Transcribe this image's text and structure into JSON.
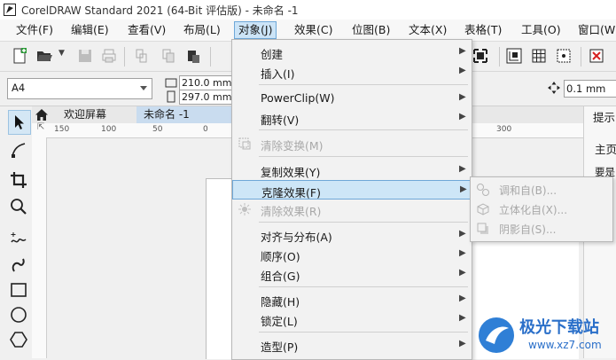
{
  "window": {
    "title": "CorelDRAW Standard 2021 (64-Bit 评估版) - 未命名 -1"
  },
  "menubar": [
    {
      "label": "文件(F)"
    },
    {
      "label": "编辑(E)"
    },
    {
      "label": "查看(V)"
    },
    {
      "label": "布局(L)"
    },
    {
      "label": "对象(J)",
      "active": true
    },
    {
      "label": "效果(C)"
    },
    {
      "label": "位图(B)"
    },
    {
      "label": "文本(X)"
    },
    {
      "label": "表格(T)"
    },
    {
      "label": "工具(O)"
    },
    {
      "label": "窗口(W)"
    }
  ],
  "propbar": {
    "page_size": "A4",
    "width": "210.0 mm",
    "height": "297.0 mm",
    "nudge": "0.1 mm"
  },
  "tabs": {
    "welcome": "欢迎屏幕",
    "document": "未命名 -1"
  },
  "ruler": {
    "ticks": [
      "150",
      "100",
      "50",
      "0",
      "300"
    ]
  },
  "docker": {
    "header": "提示",
    "line1": "主页",
    "line2": "要是"
  },
  "object_menu": [
    {
      "label": "创建",
      "submenu": true
    },
    {
      "label": "插入(I)",
      "submenu": true
    },
    {
      "sep": true
    },
    {
      "label": "PowerClip(W)",
      "submenu": true
    },
    {
      "label": "翻转(V)",
      "submenu": true
    },
    {
      "sep": true
    },
    {
      "label": "清除变换(M)",
      "disabled": true,
      "icon": "clear-transform-icon"
    },
    {
      "sep": true
    },
    {
      "label": "复制效果(Y)",
      "submenu": true
    },
    {
      "label": "克隆效果(F)",
      "submenu": true,
      "highlighted": true
    },
    {
      "label": "清除效果(R)",
      "disabled": true,
      "icon": "clear-effect-icon"
    },
    {
      "sep": true
    },
    {
      "label": "对齐与分布(A)",
      "submenu": true
    },
    {
      "label": "顺序(O)",
      "submenu": true
    },
    {
      "label": "组合(G)",
      "submenu": true
    },
    {
      "sep": true
    },
    {
      "label": "隐藏(H)",
      "submenu": true
    },
    {
      "label": "锁定(L)",
      "submenu": true
    },
    {
      "sep": true
    },
    {
      "label": "造型(P)",
      "submenu": true
    }
  ],
  "clone_effect_submenu": [
    {
      "label": "调和自(B)...",
      "disabled": true,
      "icon": "blend-icon"
    },
    {
      "label": "立体化自(X)...",
      "disabled": true,
      "icon": "extrude-icon"
    },
    {
      "label": "阴影自(S)...",
      "disabled": true,
      "icon": "shadow-icon"
    }
  ],
  "watermark": {
    "brand": "极光下载站",
    "url": "www.xz7.com"
  },
  "colors": {
    "highlight": "#cde6f7",
    "highlight_border": "#6ea8d8",
    "disabled_text": "#a8a8a8"
  }
}
